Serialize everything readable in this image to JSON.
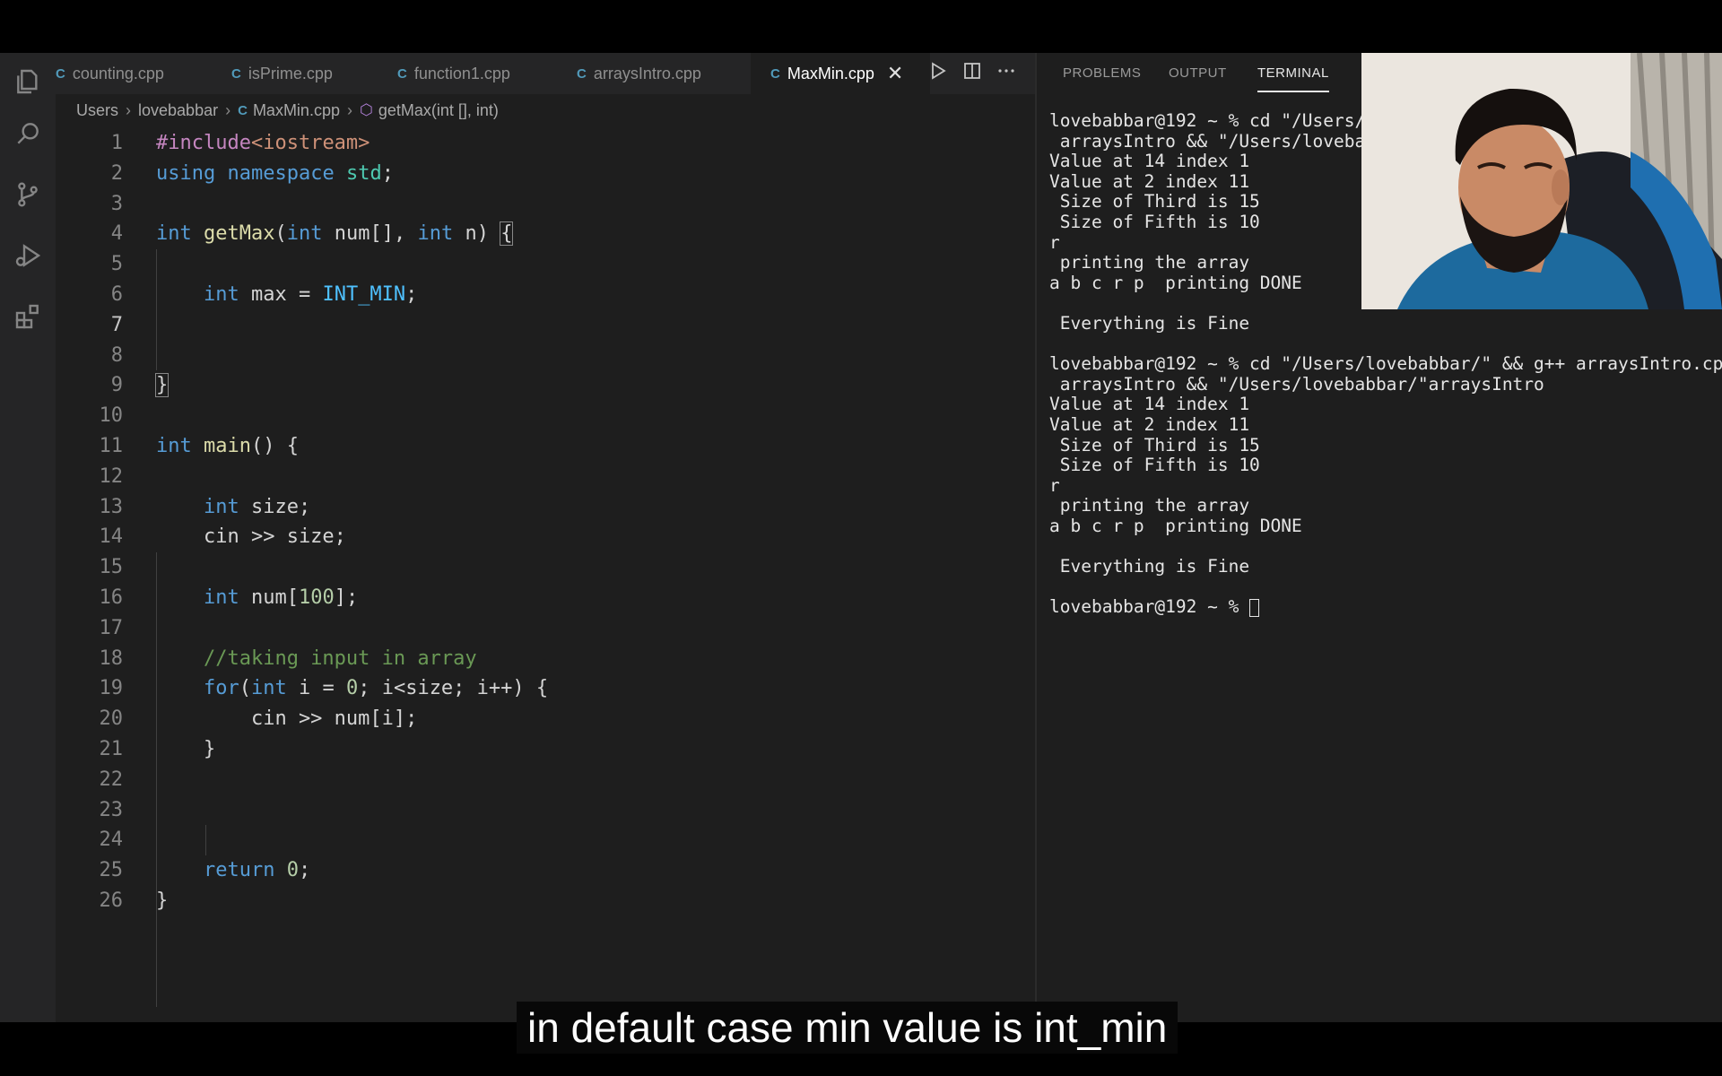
{
  "editor": {
    "tabs": [
      {
        "label": "counting.cpp",
        "active": false
      },
      {
        "label": "isPrime.cpp",
        "active": false
      },
      {
        "label": "function1.cpp",
        "active": false
      },
      {
        "label": "arraysIntro.cpp",
        "active": false
      },
      {
        "label": "MaxMin.cpp",
        "active": true
      }
    ],
    "tab_icon": "C",
    "close_glyph": "✕",
    "breadcrumb": {
      "segments": [
        "Users",
        "lovebabbar",
        "MaxMin.cpp",
        "getMax(int [], int)"
      ]
    },
    "current_line": 7,
    "lines": [
      "1",
      "2",
      "3",
      "4",
      "5",
      "6",
      "7",
      "8",
      "9",
      "10",
      "11",
      "12",
      "13",
      "14",
      "15",
      "16",
      "17",
      "18",
      "19",
      "20",
      "21",
      "22",
      "23",
      "24",
      "25",
      "26"
    ]
  },
  "panel": {
    "tabs": [
      "PROBLEMS",
      "OUTPUT",
      "TERMINAL"
    ],
    "active_tab": "TERMINAL",
    "terminal_lines": [
      "lovebabbar@192 ~ % cd \"/Users/l",
      " arraysIntro && \"/Users/lovebab",
      "Value at 14 index 1",
      "Value at 2 index 11",
      " Size of Third is 15",
      " Size of Fifth is 10",
      "r",
      " printing the array",
      "a b c r p  printing DONE",
      "",
      " Everything is Fine",
      "",
      "lovebabbar@192 ~ % cd \"/Users/lovebabbar/\" && g++ arraysIntro.cpp -",
      " arraysIntro && \"/Users/lovebabbar/\"arraysIntro",
      "Value at 14 index 1",
      "Value at 2 index 11",
      " Size of Third is 15",
      " Size of Fifth is 10",
      "r",
      " printing the array",
      "a b c r p  printing DONE",
      "",
      " Everything is Fine",
      "",
      "lovebabbar@192 ~ % "
    ]
  },
  "caption": "in default case min value is int_min",
  "colors": {
    "editor_bg": "#1e1e1e",
    "sidebar_bg": "#252526",
    "keyword": "#569cd6",
    "comment": "#6a9955",
    "string": "#ce9178",
    "number": "#b5cea8"
  }
}
